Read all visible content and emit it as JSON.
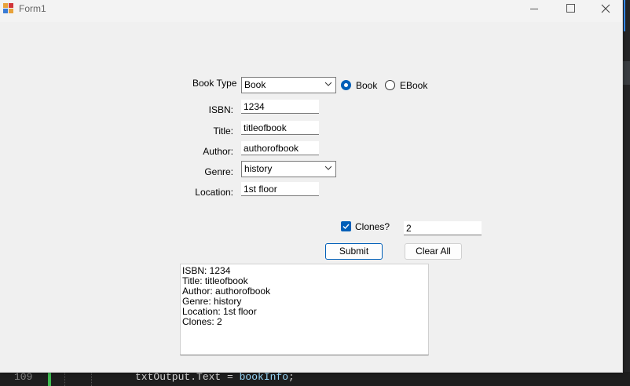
{
  "window": {
    "title": "Form1"
  },
  "form": {
    "book_type": {
      "label": "Book Type",
      "selected": "Book"
    },
    "type_radio": {
      "book_label": "Book",
      "ebook_label": "EBook",
      "selected": "Book"
    },
    "isbn": {
      "label": "ISBN:",
      "value": "1234"
    },
    "title": {
      "label": "Title:",
      "value": "titleofbook"
    },
    "author": {
      "label": "Author:",
      "value": "authorofbook"
    },
    "genre": {
      "label": "Genre:",
      "selected": "history"
    },
    "location": {
      "label": "Location:",
      "value": "1st floor"
    },
    "clones": {
      "label": "Clones?",
      "checked": true,
      "value": "2"
    },
    "submit_label": "Submit",
    "clear_label": "Clear All"
  },
  "output": {
    "lines": [
      "ISBN: 1234",
      "Title: titleofbook",
      "Author: authorofbook",
      "Genre: history",
      "Location: 1st floor",
      "Clones: 2"
    ]
  },
  "editor": {
    "line_number": "109",
    "code_prefix": "txtOutput.Text = ",
    "code_identifier": "bookInfo",
    "code_suffix": ";"
  },
  "colors": {
    "accent": "#005fb8",
    "form_bg": "#f0f0f0",
    "editor_bg": "#1e1e1e"
  }
}
